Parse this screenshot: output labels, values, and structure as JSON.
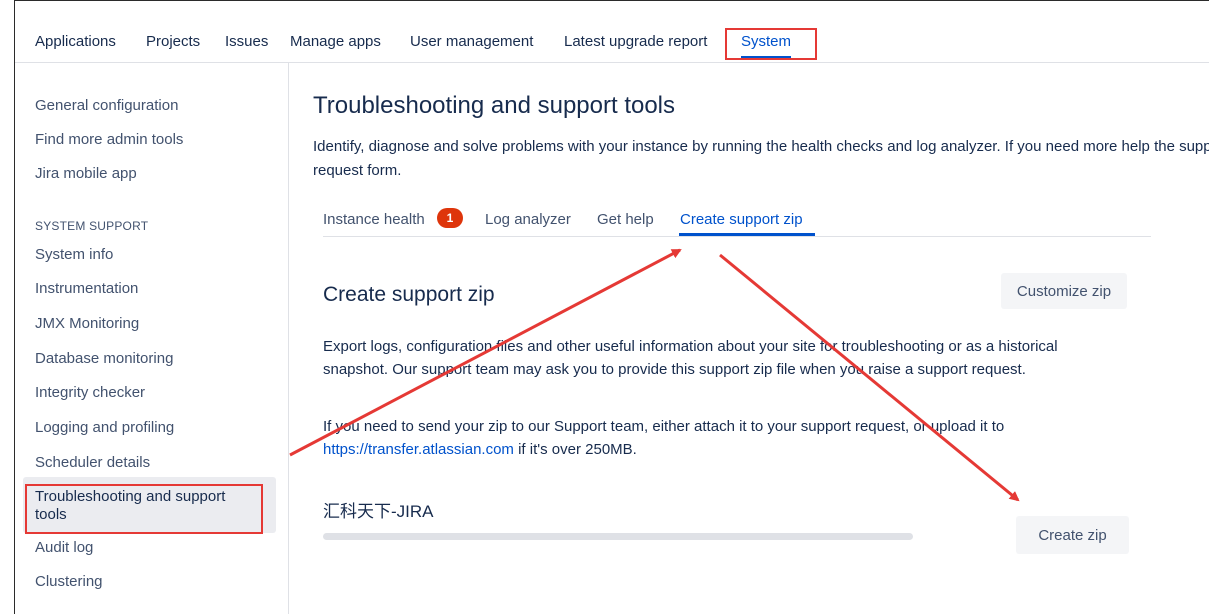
{
  "topnav": {
    "items": [
      "Applications",
      "Projects",
      "Issues",
      "Manage apps",
      "User management",
      "Latest upgrade report",
      "System"
    ],
    "active": "System"
  },
  "sidebar": {
    "links_top": [
      "General configuration",
      "Find more admin tools",
      "Jira mobile app"
    ],
    "section_heading": "SYSTEM SUPPORT",
    "links_support": [
      "System info",
      "Instrumentation",
      "JMX Monitoring",
      "Database monitoring",
      "Integrity checker",
      "Logging and profiling",
      "Scheduler details",
      "Troubleshooting and support tools",
      "Audit log",
      "Clustering"
    ],
    "active": "Troubleshooting and support tools"
  },
  "main": {
    "title": "Troubleshooting and support tools",
    "description": "Identify, diagnose and solve problems with your instance by running the health checks and log analyzer. If you need more help the support request form.",
    "tabs": [
      {
        "label": "Instance health",
        "badge": "1"
      },
      {
        "label": "Log analyzer"
      },
      {
        "label": "Get help"
      },
      {
        "label": "Create support zip"
      }
    ],
    "active_tab": "Create support zip",
    "section": {
      "title": "Create support zip",
      "customize_button": "Customize zip",
      "paragraph1": "Export logs, configuration files and other useful information about your site for troubleshooting or as a historical snapshot. Our support team may ask you to provide this support zip file when you raise a support request.",
      "paragraph2_before": "If you need to send your zip to our Support team, either attach it to your support request, or upload it to",
      "paragraph2_link": "https://transfer.atlassian.com",
      "paragraph2_after": " if it's over 250MB.",
      "instance_name": "汇科天下-JIRA",
      "progress": 0,
      "create_button": "Create zip"
    }
  },
  "annotation": {
    "color": "#e53935"
  }
}
